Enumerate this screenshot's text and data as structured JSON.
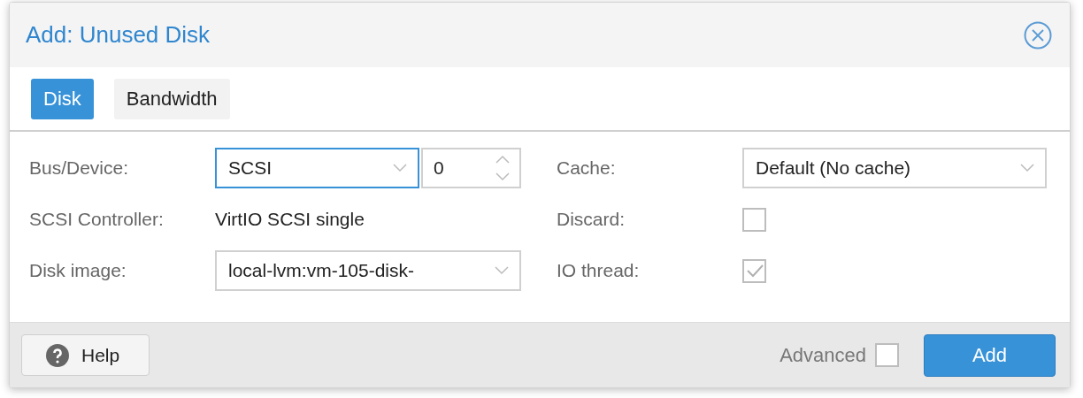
{
  "dialog": {
    "title": "Add: Unused Disk"
  },
  "tabs": [
    {
      "label": "Disk",
      "selected": true
    },
    {
      "label": "Bandwidth",
      "selected": false
    }
  ],
  "left_fields": [
    {
      "label": "Bus/Device:",
      "kind": "bus",
      "value": "SCSI",
      "focused": true,
      "device": "0"
    },
    {
      "label": "SCSI Controller:",
      "kind": "display",
      "value": "VirtIO SCSI single"
    },
    {
      "label": "Disk image:",
      "kind": "select",
      "value": "local-lvm:vm-105-disk-",
      "focused": false
    }
  ],
  "right_fields": [
    {
      "label": "Cache:",
      "kind": "select",
      "value": "Default (No cache)",
      "focused": false
    },
    {
      "label": "Discard:",
      "kind": "checkbox",
      "checked": false
    },
    {
      "label": "IO thread:",
      "kind": "checkbox",
      "checked": true
    }
  ],
  "footer": {
    "help": "Help",
    "advanced": {
      "label": "Advanced",
      "checked": false
    },
    "submit": "Add"
  }
}
